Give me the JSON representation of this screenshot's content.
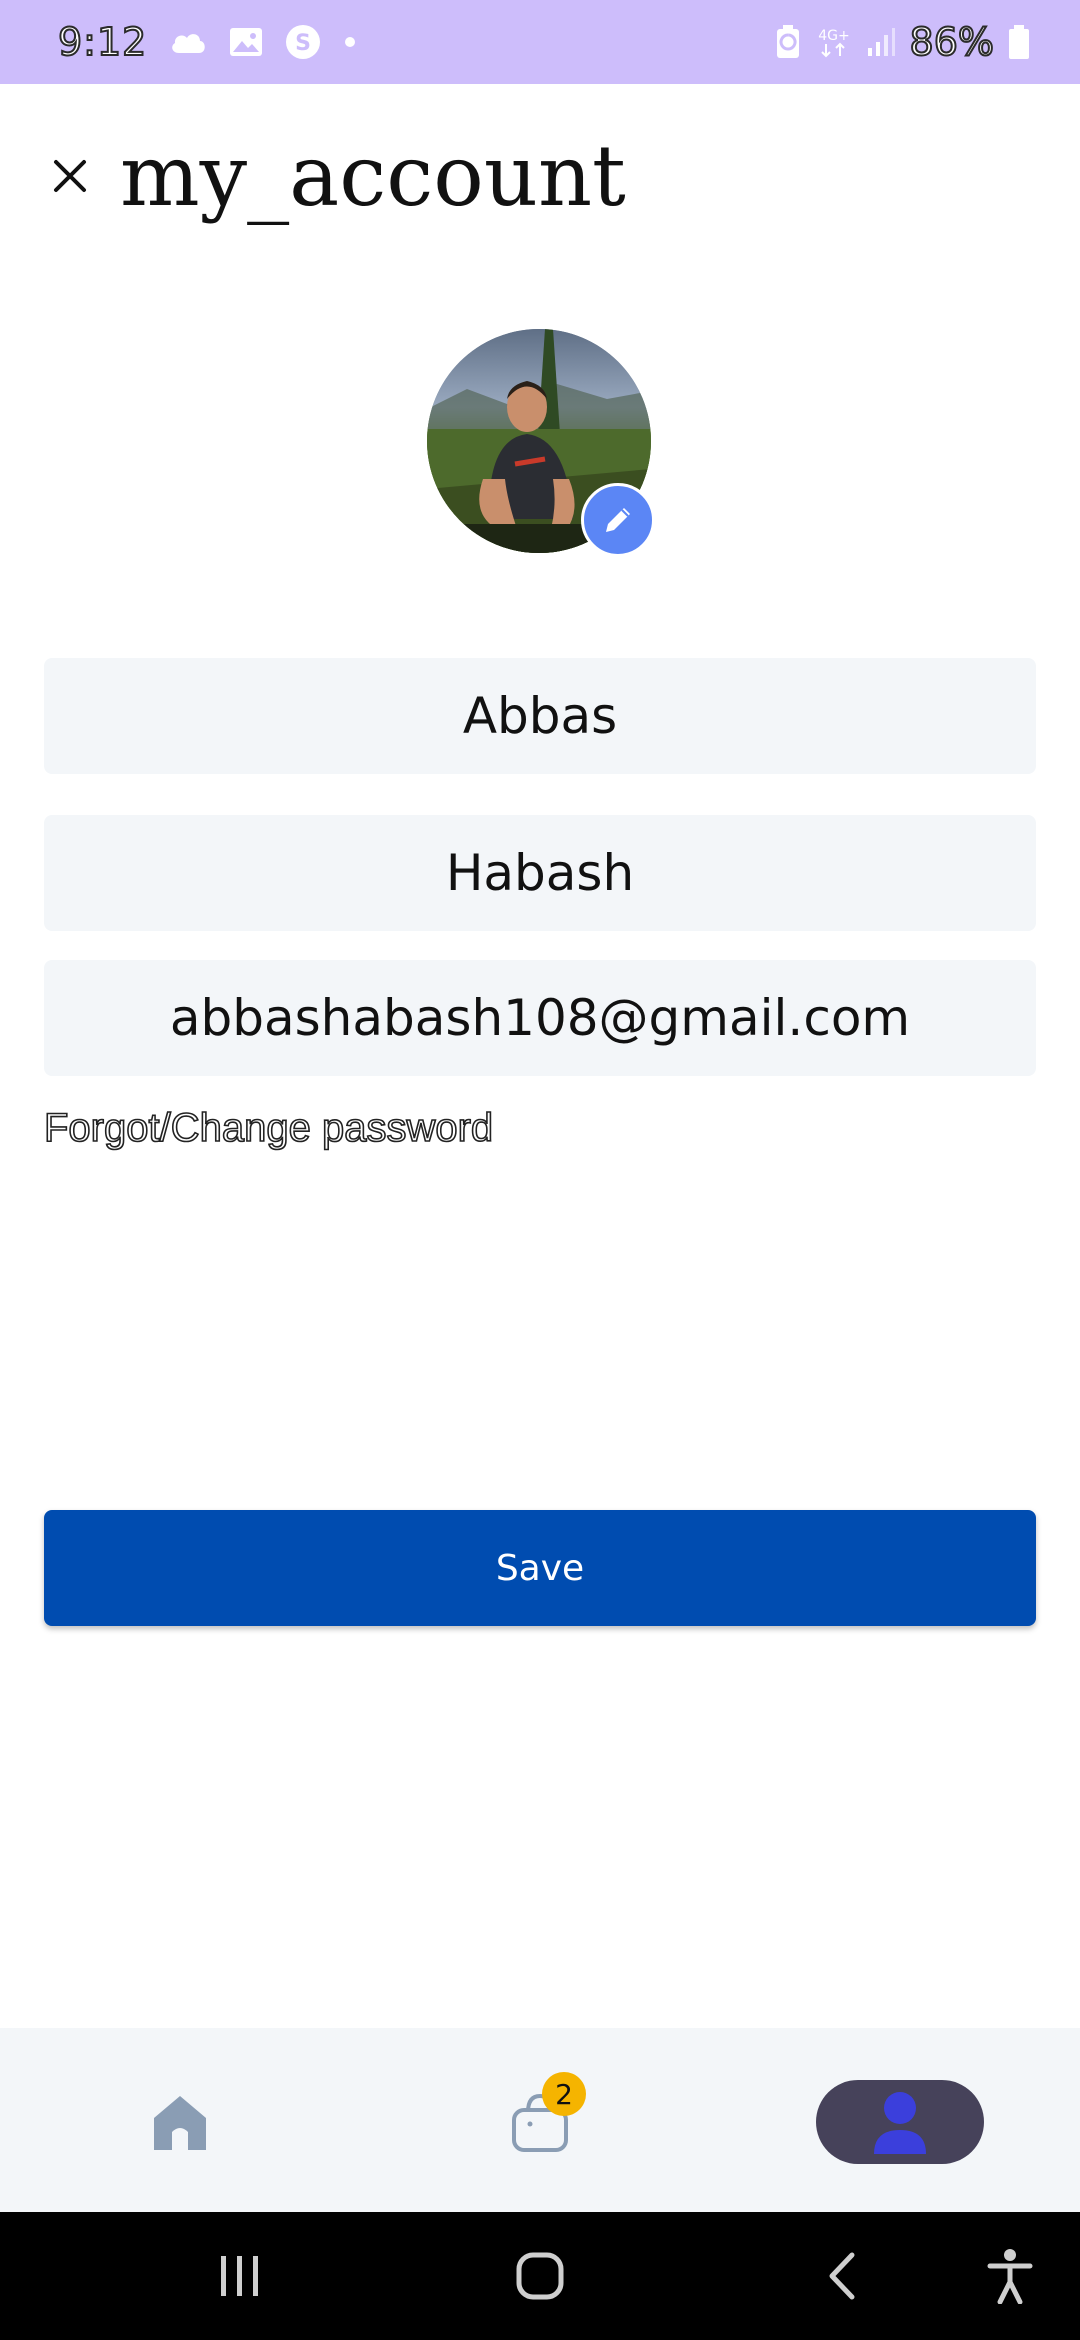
{
  "status_bar": {
    "time": "9:12",
    "battery": "86%",
    "network": "4G+",
    "icons": [
      "cloud-icon",
      "gallery-icon",
      "s-app-icon",
      "dot-icon",
      "battery-saver-icon",
      "network-4g-icon",
      "signal-icon",
      "battery-icon"
    ]
  },
  "header": {
    "title": "my_account",
    "close_icon": "close-icon"
  },
  "profile": {
    "avatar_icon": "avatar",
    "edit_icon": "pencil-icon"
  },
  "form": {
    "first_name": "Abbas",
    "last_name": "Habash",
    "email": "abbashabash108@gmail.com",
    "forgot_password": "Forgot/Change password",
    "save_label": "Save"
  },
  "bottom_nav": {
    "items": [
      {
        "icon": "home-icon",
        "active": false
      },
      {
        "icon": "shopping-bag-icon",
        "active": false,
        "badge": "2"
      },
      {
        "icon": "profile-icon",
        "active": true
      }
    ]
  },
  "colors": {
    "status_bar": "#cdbdfb",
    "primary": "#004cb0",
    "field_bg": "#f3f6f9",
    "edit_badge": "#5b86f5",
    "cart_badge": "#f5b400",
    "active_nav": "#46425a"
  },
  "system_nav": {
    "icons": [
      "recent-apps-icon",
      "home-button-icon",
      "back-icon",
      "accessibility-icon"
    ]
  }
}
